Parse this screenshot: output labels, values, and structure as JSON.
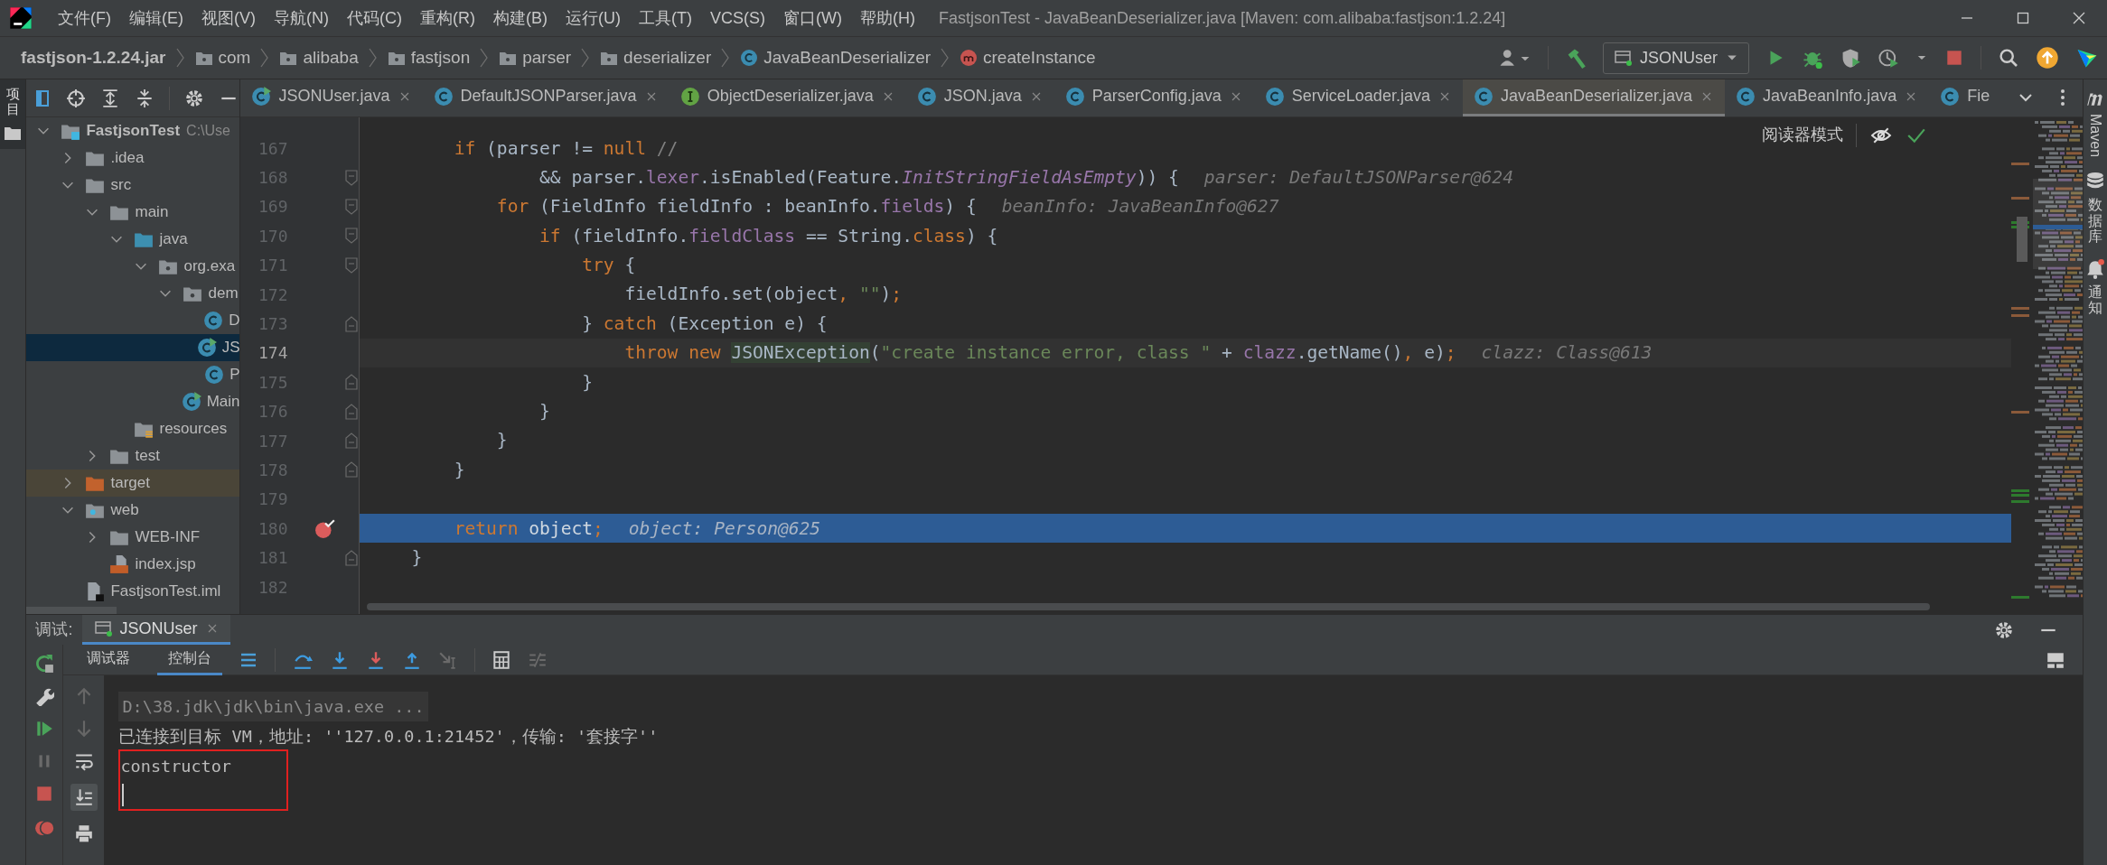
{
  "window": {
    "title": "FastjsonTest - JavaBeanDeserializer.java [Maven: com.alibaba:fastjson:1.2.24]"
  },
  "menu": [
    "文件(F)",
    "编辑(E)",
    "视图(V)",
    "导航(N)",
    "代码(C)",
    "重构(R)",
    "构建(B)",
    "运行(U)",
    "工具(T)",
    "VCS(S)",
    "窗口(W)",
    "帮助(H)"
  ],
  "breadcrumbs": [
    {
      "label": "fastjson-1.2.24.jar",
      "kind": "jar"
    },
    {
      "label": "com",
      "kind": "package"
    },
    {
      "label": "alibaba",
      "kind": "package"
    },
    {
      "label": "fastjson",
      "kind": "package"
    },
    {
      "label": "parser",
      "kind": "package"
    },
    {
      "label": "deserializer",
      "kind": "package"
    },
    {
      "label": "JavaBeanDeserializer",
      "kind": "class"
    },
    {
      "label": "createInstance",
      "kind": "method"
    }
  ],
  "run_config": {
    "label": "JSONUser"
  },
  "left_stripe": {
    "label": "项目",
    "selected": true
  },
  "project_tree": [
    {
      "label": "FastjsonTest",
      "path": "C:\\Use",
      "kind": "module",
      "expanded": true,
      "selected": false,
      "children": [
        {
          "label": ".idea",
          "kind": "folder",
          "expanded": false,
          "selected": false
        },
        {
          "label": "src",
          "kind": "folder",
          "expanded": true,
          "selected": false,
          "children": [
            {
              "label": "main",
              "kind": "folder",
              "expanded": true,
              "selected": false,
              "children": [
                {
                  "label": "java",
                  "kind": "source-folder",
                  "expanded": true,
                  "selected": false,
                  "children": [
                    {
                      "label": "org.exa",
                      "kind": "package",
                      "expanded": true,
                      "selected": false,
                      "children": [
                        {
                          "label": "dem",
                          "kind": "package",
                          "expanded": true,
                          "selected": false,
                          "children": [
                            {
                              "label": "D",
                              "kind": "class",
                              "selected": false
                            },
                            {
                              "label": "JS",
                              "kind": "class-run",
                              "selected": true
                            },
                            {
                              "label": "P",
                              "kind": "class",
                              "selected": false
                            }
                          ]
                        },
                        {
                          "label": "Main",
                          "kind": "class-run",
                          "selected": false
                        }
                      ]
                    }
                  ]
                },
                {
                  "label": "resources",
                  "kind": "resources-folder",
                  "selected": false
                }
              ]
            },
            {
              "label": "test",
              "kind": "folder",
              "expanded": false,
              "selected": false
            }
          ]
        },
        {
          "label": "target",
          "kind": "excluded-folder",
          "expanded": false,
          "selected": false
        },
        {
          "label": "web",
          "kind": "web-folder",
          "expanded": true,
          "selected": false,
          "children": [
            {
              "label": "WEB-INF",
              "kind": "folder",
              "expanded": false,
              "selected": false
            },
            {
              "label": "index.jsp",
              "kind": "jsp-file",
              "selected": false
            }
          ]
        },
        {
          "label": "FastjsonTest.iml",
          "kind": "iml-file",
          "selected": false
        }
      ]
    }
  ],
  "tabs": [
    {
      "label": "JSONUser.java",
      "kind": "class-run",
      "selected": false,
      "closable": true
    },
    {
      "label": "DefaultJSONParser.java",
      "kind": "class",
      "selected": false,
      "closable": true
    },
    {
      "label": "ObjectDeserializer.java",
      "kind": "interface",
      "selected": false,
      "closable": true
    },
    {
      "label": "JSON.java",
      "kind": "class",
      "selected": false,
      "closable": true
    },
    {
      "label": "ParserConfig.java",
      "kind": "class",
      "selected": false,
      "closable": true
    },
    {
      "label": "ServiceLoader.java",
      "kind": "class",
      "selected": false,
      "closable": true
    },
    {
      "label": "JavaBeanDeserializer.java",
      "kind": "class",
      "selected": true,
      "closable": true
    },
    {
      "label": "JavaBeanInfo.java",
      "kind": "class",
      "selected": false,
      "closable": true
    },
    {
      "label": "Fie",
      "kind": "class",
      "selected": false,
      "closable": false
    }
  ],
  "editor": {
    "reader_mode": "阅读器模式",
    "lines": [
      {
        "number": "167",
        "code": [
          {
            "kind": "keyword",
            "text": "    if"
          },
          {
            "kind": "plain",
            "text": " (parser != "
          },
          {
            "kind": "keyword",
            "text": "null"
          },
          {
            "kind": "comment",
            "text": " //"
          }
        ],
        "caret": false,
        "selected": false,
        "breakpoint": false
      },
      {
        "number": "168",
        "code": [
          {
            "kind": "plain",
            "text": "            && parser."
          },
          {
            "kind": "field",
            "text": "lexer"
          },
          {
            "kind": "plain",
            "text": ".isEnabled(Feature."
          },
          {
            "kind": "static",
            "text": "InitStringFieldAsEmpty"
          },
          {
            "kind": "plain",
            "text": ")) {"
          }
        ],
        "hint": "parser: DefaultJSONParser@624",
        "kind": "fold-start",
        "caret": false,
        "selected": false,
        "breakpoint": false
      },
      {
        "number": "169",
        "code": [
          {
            "kind": "keyword",
            "text": "        for"
          },
          {
            "kind": "plain",
            "text": " (FieldInfo fieldInfo : beanInfo."
          },
          {
            "kind": "field",
            "text": "fields"
          },
          {
            "kind": "plain",
            "text": ") {"
          }
        ],
        "hint": "beanInfo: JavaBeanInfo@627",
        "kind": "fold-start",
        "caret": false,
        "selected": false,
        "breakpoint": false
      },
      {
        "number": "170",
        "code": [
          {
            "kind": "keyword",
            "text": "            if"
          },
          {
            "kind": "plain",
            "text": " (fieldInfo."
          },
          {
            "kind": "field",
            "text": "fieldClass"
          },
          {
            "kind": "plain",
            "text": " == String."
          },
          {
            "kind": "keyword",
            "text": "class"
          },
          {
            "kind": "plain",
            "text": ") {"
          }
        ],
        "kind": "fold-start",
        "caret": false,
        "selected": false,
        "breakpoint": false
      },
      {
        "number": "171",
        "code": [
          {
            "kind": "keyword",
            "text": "                try"
          },
          {
            "kind": "plain",
            "text": " {"
          }
        ],
        "kind": "fold-start",
        "caret": false,
        "selected": false,
        "breakpoint": false
      },
      {
        "number": "172",
        "code": [
          {
            "kind": "plain",
            "text": "                    fieldInfo.set(object"
          },
          {
            "kind": "keyword",
            "text": ", "
          },
          {
            "kind": "string",
            "text": "\"\""
          },
          {
            "kind": "plain",
            "text": ")"
          },
          {
            "kind": "keyword",
            "text": ";"
          }
        ],
        "caret": false,
        "selected": false,
        "breakpoint": false
      },
      {
        "number": "173",
        "code": [
          {
            "kind": "plain",
            "text": "                } "
          },
          {
            "kind": "keyword",
            "text": "catch"
          },
          {
            "kind": "plain",
            "text": " (Exception e) {"
          }
        ],
        "kind": "fold-end",
        "caret": false,
        "selected": false,
        "breakpoint": false
      },
      {
        "number": "174",
        "code": [
          {
            "kind": "keyword",
            "text": "                    throw new "
          },
          {
            "kind": "reference",
            "text": "JSONException"
          },
          {
            "kind": "plain",
            "text": "("
          },
          {
            "kind": "string",
            "text": "\"create instance error, class \""
          },
          {
            "kind": "plain",
            "text": " + "
          },
          {
            "kind": "field",
            "text": "clazz"
          },
          {
            "kind": "plain",
            "text": ".getName()"
          },
          {
            "kind": "keyword",
            "text": ", "
          },
          {
            "kind": "plain",
            "text": "e)"
          },
          {
            "kind": "keyword",
            "text": ";"
          }
        ],
        "hint": "clazz: Class@613",
        "caret": true,
        "selected": false,
        "breakpoint": false
      },
      {
        "number": "175",
        "code": [
          {
            "kind": "plain",
            "text": "                }"
          }
        ],
        "kind": "fold-end",
        "caret": false,
        "selected": false,
        "breakpoint": false
      },
      {
        "number": "176",
        "code": [
          {
            "kind": "plain",
            "text": "            }"
          }
        ],
        "kind": "fold-end",
        "caret": false,
        "selected": false,
        "breakpoint": false
      },
      {
        "number": "177",
        "code": [
          {
            "kind": "plain",
            "text": "        }"
          }
        ],
        "kind": "fold-end",
        "caret": false,
        "selected": false,
        "breakpoint": false
      },
      {
        "number": "178",
        "code": [
          {
            "kind": "plain",
            "text": "    }"
          }
        ],
        "kind": "fold-end",
        "caret": false,
        "selected": false,
        "breakpoint": false
      },
      {
        "number": "179",
        "caret": false,
        "selected": false,
        "breakpoint": false
      },
      {
        "number": "180",
        "code": [
          {
            "kind": "keyword",
            "text": "    return "
          },
          {
            "kind": "plain",
            "text": "object"
          },
          {
            "kind": "keyword",
            "text": ";"
          }
        ],
        "hint": "object: Person@625",
        "caret": false,
        "selected": true,
        "breakpoint": true
      },
      {
        "number": "181",
        "code": [
          {
            "kind": "plain",
            "text": "}"
          }
        ],
        "kind": "fold-end",
        "caret": false,
        "selected": false,
        "breakpoint": false
      },
      {
        "number": "182",
        "caret": false,
        "selected": false,
        "breakpoint": false
      }
    ]
  },
  "right_stripe": [
    {
      "label": "Maven",
      "kind": "maven"
    },
    {
      "label": "数据库",
      "kind": "database"
    },
    {
      "label": "通知",
      "kind": "notifications"
    }
  ],
  "debug_panel": {
    "title": "调试:",
    "session_tab": {
      "label": "JSONUser",
      "selected": true
    },
    "tabs": [
      {
        "label": "调试器",
        "selected": false
      },
      {
        "label": "控制台",
        "selected": true
      }
    ],
    "console": {
      "input_caret": true,
      "lines": [
        {
          "text": "D:\\38.jdk\\jdk\\bin\\java.exe ...",
          "kind": "command",
          "framed": false
        },
        {
          "text": "已连接到目标 VM，地址: ''127.0.0.1:21452'，传输: '套接字''",
          "kind": "info",
          "framed": false
        },
        {
          "text": "constructor",
          "kind": "output",
          "framed": true
        }
      ]
    }
  }
}
